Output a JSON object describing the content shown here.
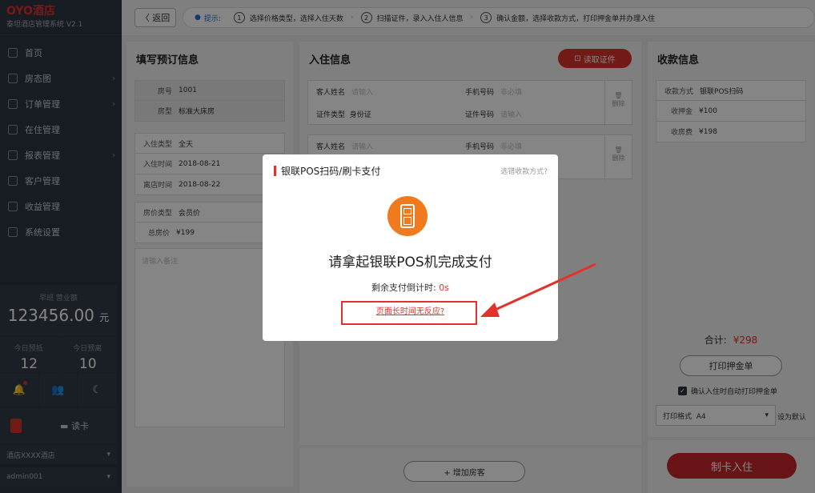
{
  "sidebar": {
    "logo": "OYO酒店",
    "system_name": "泰坦酒店管理系统 V2.1",
    "nav": [
      {
        "label": "首页",
        "icon": "home-icon",
        "arrow": false
      },
      {
        "label": "房态图",
        "icon": "grid-icon",
        "arrow": true
      },
      {
        "label": "订单管理",
        "icon": "order-icon",
        "arrow": true
      },
      {
        "label": "在住管理",
        "icon": "bed-icon",
        "arrow": false
      },
      {
        "label": "报表管理",
        "icon": "report-icon",
        "arrow": true
      },
      {
        "label": "客户管理",
        "icon": "user-icon",
        "arrow": false
      },
      {
        "label": "收益管理",
        "icon": "revenue-icon",
        "arrow": false
      },
      {
        "label": "系统设置",
        "icon": "settings-icon",
        "arrow": false
      }
    ],
    "shift_label": "早班  营业额",
    "revenue": "123456.00",
    "revenue_unit": "元",
    "today_checkin_label": "今日预抵",
    "today_checkin": "12",
    "today_booking_label": "今日预离",
    "today_booking": "10",
    "read_card": "读卡",
    "hotel_select": "酒店XXXX酒店",
    "user_select": "admin001"
  },
  "topbar": {
    "back": "返回",
    "tip_label": "提示:",
    "steps": [
      {
        "n": "1",
        "text": "选择价格类型，选择入住天数"
      },
      {
        "n": "2",
        "text": "扫描证件，录入入住人信息"
      },
      {
        "n": "3",
        "text": "确认金额，选择收款方式，打印押金单并办理入住"
      }
    ]
  },
  "booking": {
    "title": "填写预订信息",
    "room_no_k": "房号",
    "room_no": "1001",
    "room_type_k": "房型",
    "room_type": "标准大床房",
    "stay_type_k": "入住类型",
    "stay_type": "全天",
    "checkin_k": "入住时间",
    "checkin": "2018-08-21",
    "checkout_k": "离店时间",
    "checkout": "2018-08-22",
    "price_type_k": "房价类型",
    "price_type": "会员价",
    "total_price_k": "总房价",
    "total_price": "¥199",
    "remark_placeholder": "请输入备注"
  },
  "guest": {
    "title": "入住信息",
    "read_id": "读取证件",
    "name_k": "客人姓名",
    "name_ph": "请输入",
    "phone_k": "手机号码",
    "phone_ph": "非必填",
    "idtype_k": "证件类型",
    "idtype": "身份证",
    "idno_k": "证件号码",
    "idno_ph": "请输入",
    "delete": "删除",
    "add_guest": "+ 增加房客"
  },
  "payment": {
    "title": "收款信息",
    "method_k": "收款方式",
    "method": "银联POS扫码",
    "deposit_k": "收押金",
    "deposit": "¥100",
    "room_fee_k": "收房费",
    "room_fee": "¥198",
    "total_k": "合计:",
    "total": "¥298",
    "print_deposit": "打印押金单",
    "auto_print": "确认入住时自动打印押金单",
    "format_k": "打印格式",
    "format": "A4",
    "set_default": "设为默认",
    "make_card": "制卡入住"
  },
  "modal": {
    "title": "银联POS扫码/刷卡支付",
    "switch": "选错收款方式?",
    "main": "请拿起银联POS机完成支付",
    "countdown_label": "剩余支付倒计时:",
    "countdown": "0s",
    "no_response": "页面长时间无反应?"
  }
}
